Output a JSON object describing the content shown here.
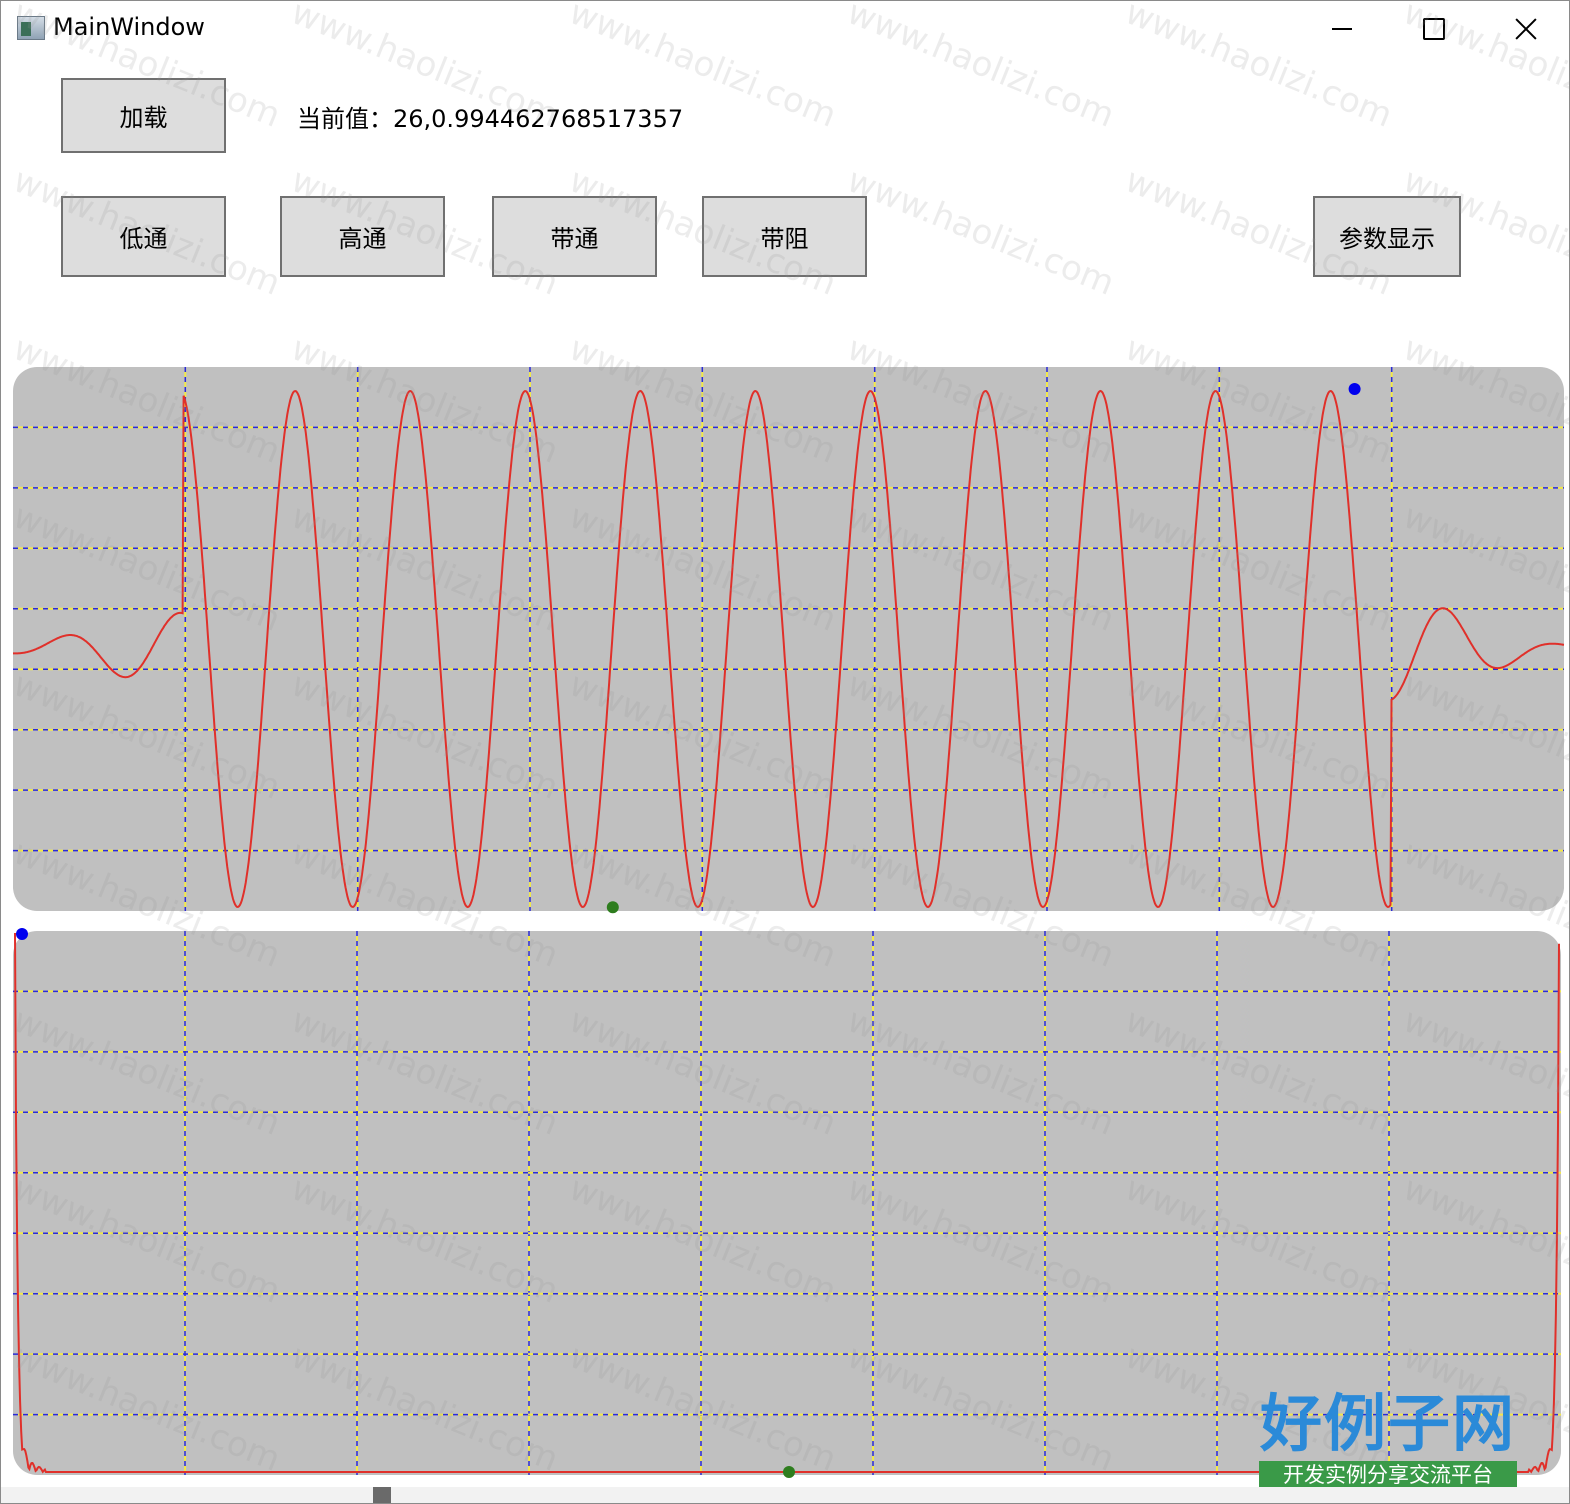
{
  "window": {
    "title": "MainWindow",
    "icon": "app-window-icon",
    "controls": [
      "minimize-icon",
      "maximize-icon",
      "close-icon"
    ]
  },
  "toolbar": {
    "load_label": "加载",
    "current_value_text": "当前值：26,0.994462768517357",
    "lowpass_label": "低通",
    "highpass_label": "高通",
    "bandpass_label": "带通",
    "bandstop_label": "带阻",
    "params_label": "参数显示"
  },
  "watermark": {
    "text": "www.haolizi.com",
    "logo_text": "好例子网",
    "logo_subtext": "开发实例分享交流平台"
  },
  "colors": {
    "plot_background": "#c0c0c0",
    "curve": "#e0302a",
    "grid_blue": "#2b2bd6",
    "grid_yellow": "#f2e84a",
    "max_marker": "#0000ee",
    "min_marker": "#2e7d1e"
  },
  "chart_data": [
    {
      "type": "line",
      "title": "",
      "description_role": "time-domain signal",
      "x_range": [
        0,
        1
      ],
      "y_range": [
        -1,
        1
      ],
      "grid": true,
      "grid_columns": 9,
      "grid_rows": 9,
      "series": [
        {
          "samples": 361,
          "signal": "windowed-sine",
          "oscillations": 10
        }
      ],
      "max_marker": {
        "x": 0.865,
        "y": 1.0
      },
      "min_marker": {
        "x": 0.379,
        "y": -0.97
      }
    },
    {
      "type": "line",
      "title": "",
      "description_role": "frequency spectrum",
      "x_range": [
        0,
        1
      ],
      "y_range": [
        0,
        1
      ],
      "grid": true,
      "grid_columns": 9,
      "grid_rows": 9,
      "series": [
        {
          "signal": "edge-peaks",
          "peak_left": 1.0,
          "peak_right": 0.98,
          "baseline": 0.0
        }
      ],
      "max_marker": {
        "x": 0.0,
        "y": 1.0
      },
      "min_marker": {
        "x": 0.5,
        "y": 0.0
      }
    }
  ]
}
